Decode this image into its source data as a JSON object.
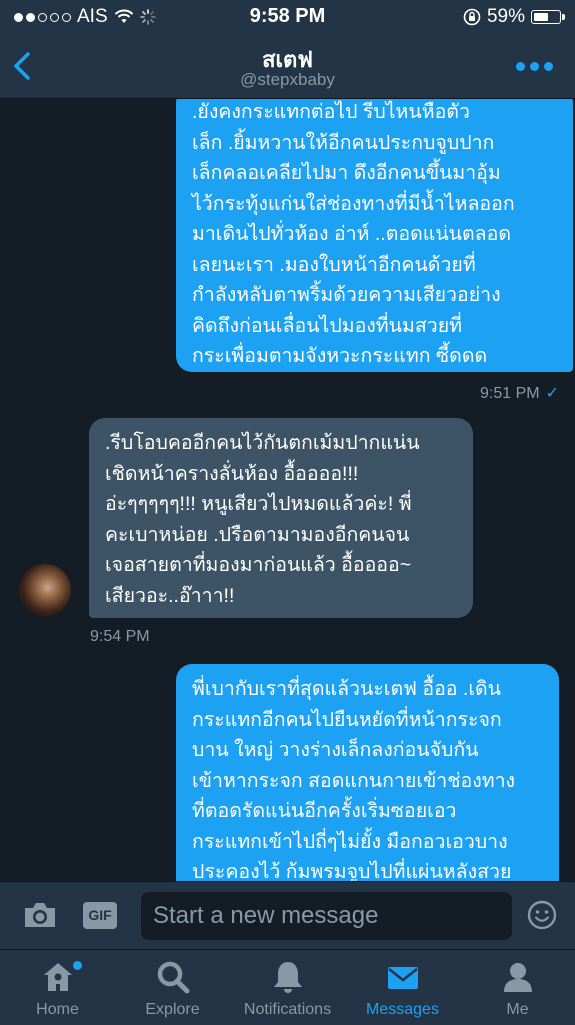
{
  "status": {
    "carrier": "AIS",
    "time": "9:58 PM",
    "battery": "59%",
    "battery_level": 0.59
  },
  "header": {
    "name": "สเตฟ",
    "handle": "@stepxbaby"
  },
  "messages": [
    {
      "direction": "out",
      "lines": [
        ".ยังคงกระแทกต่อไป รีบไหนหือตัว",
        "เล็ก .ยิ้มหวานให้อีกคนประกบจูบปาก",
        "เล็กคลอเคลียไปมา ดึงอีกคนขึ้นมาอุ้ม",
        "ไว้กระทุ้งแก่นใส่ช่องทางที่มีน้ำไหลออก",
        "มาเดินไปทั่วห้อง อ่าห์ ..ตอดแน่นตลอด",
        "เลยนะเรา .มองใบหน้าอีกคนด้วยที่",
        "กำลังหลับตาพริ้มด้วยความเสียวอย่าง",
        "คิดถึงก่อนเลื่อนไปมองที่นมสวยที่",
        "กระเพื่อมตามจังหวะกระแทก ซี้ดดด"
      ],
      "time": "9:51 PM",
      "read_mark": "✓"
    },
    {
      "direction": "in",
      "lines": [
        ".รีบโอบคออีกคนไว้กันตกเม้มปากแน่น",
        "เชิดหน้าครางลั่นห้อง อื้ออออ!!!",
        "อ่ะๆๆๆๆๆ!!! หนูเสียวไปหมดแล้วค่ะ! พี่",
        "คะเบาหน่อย .ปรือตามามองอีกคนจน",
        "เจอสายตาที่มองมาก่อนแล้ว อื้ออออ~",
        "เสียวอะ..อ๊าาา!!"
      ],
      "time": "9:54 PM"
    },
    {
      "direction": "out",
      "lines": [
        "พี่เบากับเราที่สุดแล้วนะเตฟ อื้ออ .เดิน",
        "กระแทกอีกคนไปยืนหยัดที่หน้ากระจก",
        "บาน ใหญ่ วางร่างเล็กลงก่อนจับกัน",
        "เข้าหากระจก สอดแกนกายเข้าช่องทาง",
        "ที่ตอดรัดแน่นอีกครั้งเริ่มซอยเอว",
        "กระแทกเข้าไปถี่ๆไม่ยั้ง มือกอวเอวบาง",
        "ประคองไว้ ก้มพรมจูบไปที่แผ่นหลังสวย"
      ]
    }
  ],
  "composer": {
    "placeholder": "Start a new message",
    "gif_label": "GIF"
  },
  "tabs": [
    {
      "label": "Home",
      "icon": "home-icon"
    },
    {
      "label": "Explore",
      "icon": "search-icon"
    },
    {
      "label": "Notifications",
      "icon": "bell-icon"
    },
    {
      "label": "Messages",
      "icon": "envelope-icon"
    },
    {
      "label": "Me",
      "icon": "person-icon"
    }
  ],
  "colors": {
    "accent": "#1da1f2",
    "background": "#141d26",
    "bar": "#243447",
    "incoming_bubble": "#3d5466",
    "muted": "#8899a6"
  }
}
